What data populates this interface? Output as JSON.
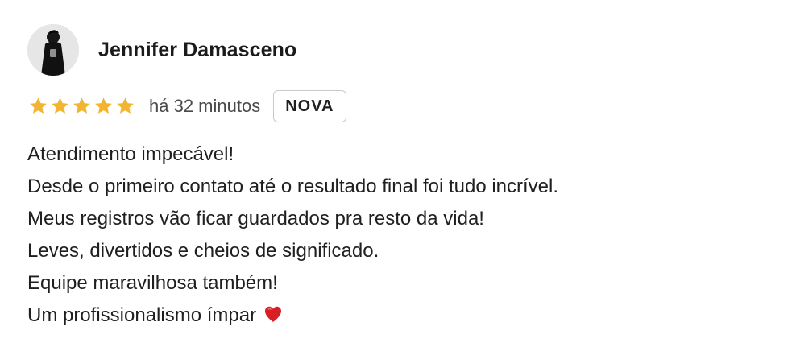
{
  "review": {
    "author": "Jennifer Damasceno",
    "rating": 5,
    "rating_max": 5,
    "time_ago": "há 32 minutos",
    "badge": "NOVA",
    "lines": [
      "Atendimento impecável!",
      "Desde o primeiro contato até o resultado final foi tudo incrível.",
      "Meus registros vão ficar guardados pra resto da vida!",
      "Leves, divertidos e cheios de significado.",
      "Equipe maravilhosa também!",
      "Um profissionalismo ímpar"
    ],
    "line_end_icon": "red-heart-icon"
  },
  "colors": {
    "star": "#f2b531",
    "heart": "#d81f26",
    "badge_border": "#c9c9c9"
  }
}
